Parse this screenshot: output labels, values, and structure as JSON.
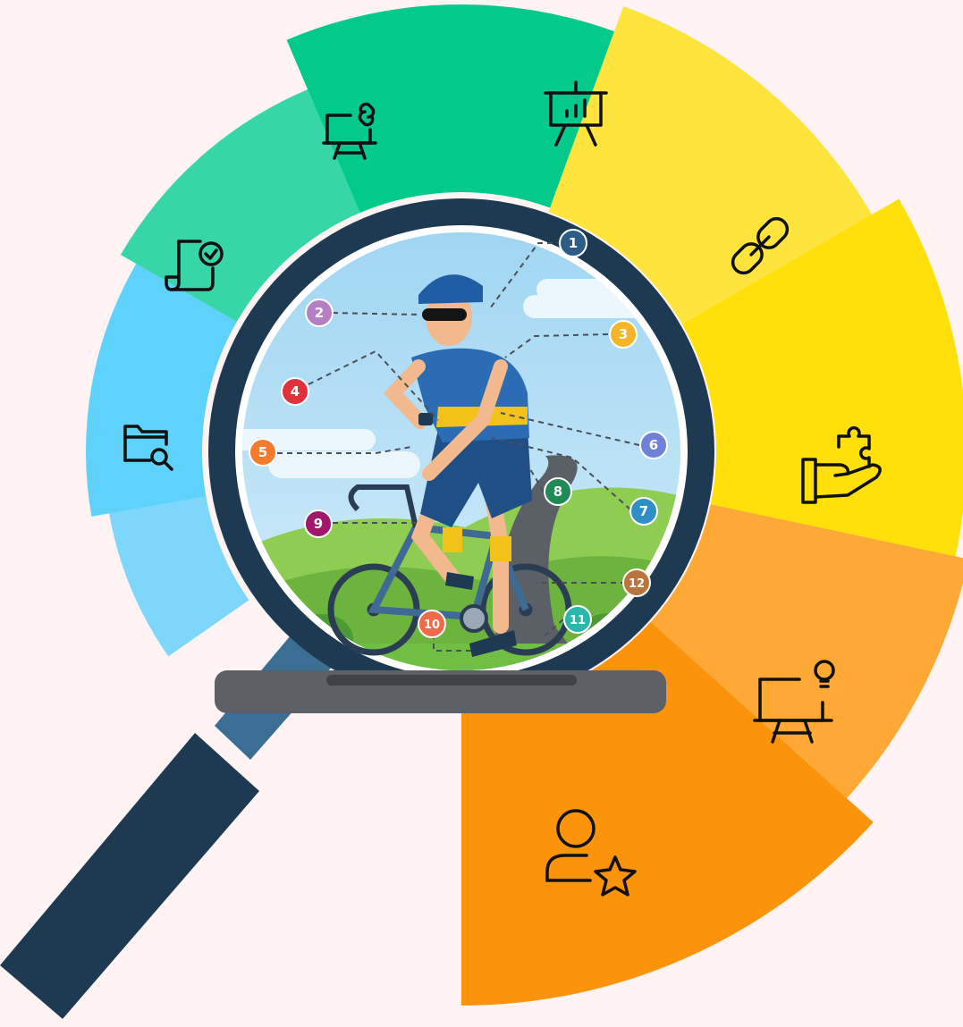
{
  "colors": {
    "background": "#fff4f3",
    "handle": "#1e3a52",
    "rim": "#1e3a52",
    "sky": "#bfe3f5",
    "hills": "#7cc04a",
    "road": "#5b5f66"
  },
  "segments": [
    {
      "icon": "folder-search-icon",
      "color": "#7fd6fb"
    },
    {
      "icon": "document-check-icon",
      "color": "#5ed2fa"
    },
    {
      "icon": "presentation-link-icon",
      "color": "#37d6a8"
    },
    {
      "icon": "presentation-chart-icon",
      "color": "#03c98b"
    },
    {
      "icon": "link-icon",
      "color": "#ffe43d"
    },
    {
      "icon": "hand-puzzle-icon",
      "color": "#ffe00a"
    },
    {
      "icon": "presentation-idea-icon",
      "color": "#fea835"
    },
    {
      "icon": "user-star-icon",
      "color": "#fb940b"
    }
  ],
  "markers": [
    {
      "label": "1",
      "color": "#2b5d86"
    },
    {
      "label": "2",
      "color": "#b57fc4"
    },
    {
      "label": "3",
      "color": "#f4b52b"
    },
    {
      "label": "4",
      "color": "#e0323c"
    },
    {
      "label": "5",
      "color": "#f47a2e"
    },
    {
      "label": "6",
      "color": "#6e80d8"
    },
    {
      "label": "7",
      "color": "#2e8fc6"
    },
    {
      "label": "8",
      "color": "#1f8a56"
    },
    {
      "label": "9",
      "color": "#a0176b"
    },
    {
      "label": "10",
      "color": "#f06a4a"
    },
    {
      "label": "11",
      "color": "#2ab8ad"
    },
    {
      "label": "12",
      "color": "#b8753d"
    }
  ]
}
